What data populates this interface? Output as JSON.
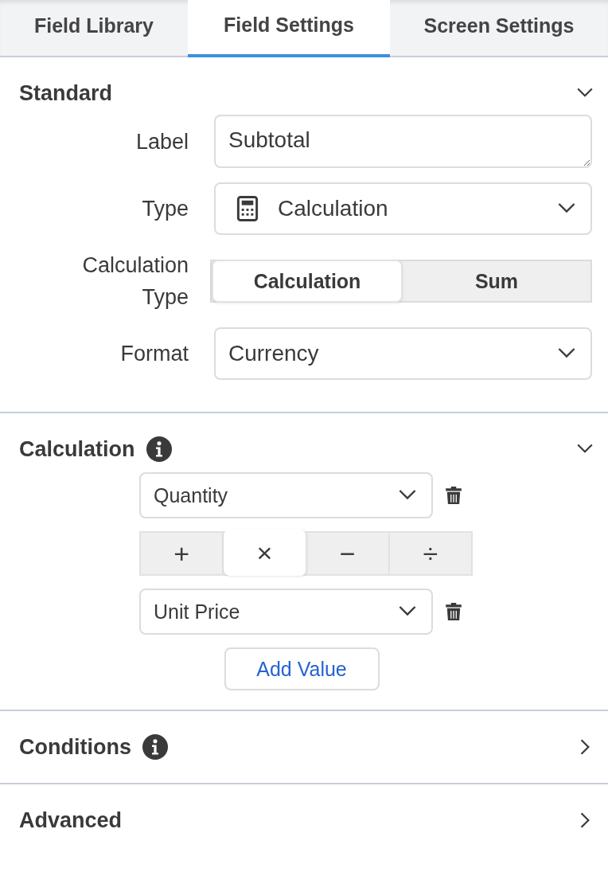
{
  "tabs": [
    {
      "label": "Field Library",
      "selected": false
    },
    {
      "label": "Field Settings",
      "selected": true
    },
    {
      "label": "Screen Settings",
      "selected": false
    }
  ],
  "sections": [
    {
      "title": "Standard",
      "info": false,
      "expanded": true,
      "kind": "standard",
      "fields": [
        {
          "kind": "textarea",
          "label": "Label",
          "value": "Subtotal"
        },
        {
          "kind": "select",
          "label": "Type",
          "value": "Calculation",
          "icon": true
        },
        {
          "kind": "segmented",
          "label": "Calculation Type",
          "options": [
            {
              "label": "Calculation",
              "selected": true
            },
            {
              "label": "Sum",
              "selected": false
            }
          ]
        },
        {
          "kind": "select",
          "label": "Format",
          "value": "Currency",
          "icon": false
        }
      ]
    },
    {
      "title": "Calculation",
      "info": true,
      "expanded": true,
      "kind": "calculation",
      "operands": [
        "Quantity",
        "Unit Price"
      ],
      "operators": [
        {
          "label": "+",
          "selected": false
        },
        {
          "label": "×",
          "selected": true
        },
        {
          "label": "−",
          "selected": false
        },
        {
          "label": "÷",
          "selected": false
        }
      ],
      "add_button": "Add Value"
    },
    {
      "title": "Conditions",
      "info": true,
      "expanded": false,
      "kind": "plain"
    },
    {
      "title": "Advanced",
      "info": false,
      "expanded": false,
      "kind": "plain"
    }
  ]
}
